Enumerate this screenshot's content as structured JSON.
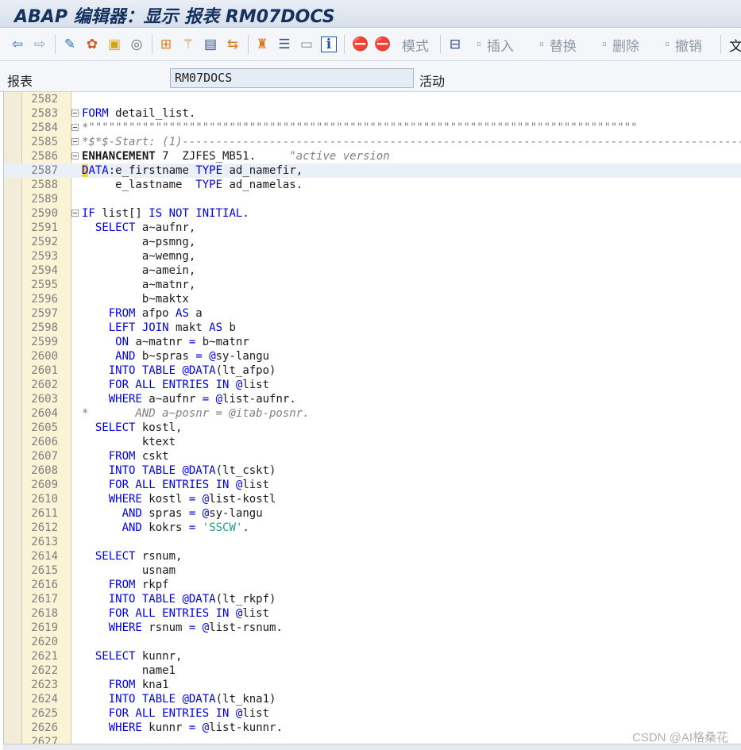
{
  "window": {
    "title": "ABAP 编辑器：显示 报表 RM07DOCS"
  },
  "toolbar": {
    "mode_label": "模式",
    "insert_label": "插入",
    "replace_label": "替换",
    "delete_label": "删除",
    "undo_label": "撤销",
    "doc_label": "文"
  },
  "report": {
    "label": "报表",
    "value": "RM07DOCS",
    "status": "活动"
  },
  "watermark": "CSDN @AI格桑花",
  "code": {
    "current_line": "2587",
    "lines": [
      {
        "n": "2582",
        "fold": false,
        "parts": []
      },
      {
        "n": "2583",
        "fold": true,
        "parts": [
          {
            "t": "FORM",
            "k": "k"
          },
          {
            "t": " detail_list.",
            "k": ""
          }
        ]
      },
      {
        "n": "2584",
        "fold": true,
        "parts": [
          {
            "t": "*\"\"\"\"\"\"\"\"\"\"\"\"\"\"\"\"\"\"\"\"\"\"\"\"\"\"\"\"\"\"\"\"\"\"\"\"\"\"\"\"\"\"\"\"\"\"\"\"\"\"\"\"\"\"\"\"\"\"\"\"\"\"\"\"\"\"\"\"\"\"\"\"\"\"\"\"\"\"\"\"\"\"",
            "k": "c"
          }
        ]
      },
      {
        "n": "2585",
        "fold": true,
        "parts": [
          {
            "t": "*$*$-Start: (1)----------------------------------------------------------------------------------------",
            "k": "c"
          }
        ]
      },
      {
        "n": "2586",
        "fold": true,
        "parts": [
          {
            "t": "ENHANCEMENT",
            "k": "b"
          },
          {
            "t": " 7  ZJFES_MB51.     ",
            "k": ""
          },
          {
            "t": "\"active version",
            "k": "c"
          }
        ]
      },
      {
        "n": "2587",
        "fold": false,
        "parts": [
          {
            "t": "D",
            "k": "k cursor"
          },
          {
            "t": "ATA",
            "k": "k"
          },
          {
            "t": ":e_firstname ",
            "k": ""
          },
          {
            "t": "TYPE",
            "k": "k"
          },
          {
            "t": " ad_namefir,",
            "k": ""
          }
        ]
      },
      {
        "n": "2588",
        "fold": false,
        "parts": [
          {
            "t": "     e_lastname  ",
            "k": ""
          },
          {
            "t": "TYPE",
            "k": "k"
          },
          {
            "t": " ad_namelas.",
            "k": ""
          }
        ]
      },
      {
        "n": "2589",
        "fold": false,
        "parts": []
      },
      {
        "n": "2590",
        "fold": true,
        "parts": [
          {
            "t": "IF",
            "k": "k"
          },
          {
            "t": " list[] ",
            "k": ""
          },
          {
            "t": "IS NOT INITIAL",
            "k": "k"
          },
          {
            "t": ".",
            "k": ""
          }
        ]
      },
      {
        "n": "2591",
        "fold": false,
        "parts": [
          {
            "t": "  ",
            "k": ""
          },
          {
            "t": "SELECT",
            "k": "k"
          },
          {
            "t": " a~aufnr,",
            "k": ""
          }
        ]
      },
      {
        "n": "2592",
        "fold": false,
        "parts": [
          {
            "t": "         a~psmng,",
            "k": ""
          }
        ]
      },
      {
        "n": "2593",
        "fold": false,
        "parts": [
          {
            "t": "         a~wemng,",
            "k": ""
          }
        ]
      },
      {
        "n": "2594",
        "fold": false,
        "parts": [
          {
            "t": "         a~amein,",
            "k": ""
          }
        ]
      },
      {
        "n": "2595",
        "fold": false,
        "parts": [
          {
            "t": "         a~matnr,",
            "k": ""
          }
        ]
      },
      {
        "n": "2596",
        "fold": false,
        "parts": [
          {
            "t": "         b~maktx",
            "k": ""
          }
        ]
      },
      {
        "n": "2597",
        "fold": false,
        "parts": [
          {
            "t": "    ",
            "k": ""
          },
          {
            "t": "FROM",
            "k": "k"
          },
          {
            "t": " afpo ",
            "k": ""
          },
          {
            "t": "AS",
            "k": "k"
          },
          {
            "t": " a",
            "k": ""
          }
        ]
      },
      {
        "n": "2598",
        "fold": false,
        "parts": [
          {
            "t": "    ",
            "k": ""
          },
          {
            "t": "LEFT JOIN",
            "k": "k"
          },
          {
            "t": " makt ",
            "k": ""
          },
          {
            "t": "AS",
            "k": "k"
          },
          {
            "t": " b",
            "k": ""
          }
        ]
      },
      {
        "n": "2599",
        "fold": false,
        "parts": [
          {
            "t": "     ",
            "k": ""
          },
          {
            "t": "ON",
            "k": "k"
          },
          {
            "t": " a~matnr ",
            "k": ""
          },
          {
            "t": "=",
            "k": "k"
          },
          {
            "t": " b~matnr",
            "k": ""
          }
        ]
      },
      {
        "n": "2600",
        "fold": false,
        "parts": [
          {
            "t": "     ",
            "k": ""
          },
          {
            "t": "AND",
            "k": "k"
          },
          {
            "t": " b~spras ",
            "k": ""
          },
          {
            "t": "=",
            "k": "k"
          },
          {
            "t": " ",
            "k": ""
          },
          {
            "t": "@",
            "k": "k"
          },
          {
            "t": "sy-langu",
            "k": ""
          }
        ]
      },
      {
        "n": "2601",
        "fold": false,
        "parts": [
          {
            "t": "    ",
            "k": ""
          },
          {
            "t": "INTO TABLE",
            "k": "k"
          },
          {
            "t": " ",
            "k": ""
          },
          {
            "t": "@DATA",
            "k": "k"
          },
          {
            "t": "(lt_afpo)",
            "k": ""
          }
        ]
      },
      {
        "n": "2602",
        "fold": false,
        "parts": [
          {
            "t": "    ",
            "k": ""
          },
          {
            "t": "FOR ALL ENTRIES IN",
            "k": "k"
          },
          {
            "t": " ",
            "k": ""
          },
          {
            "t": "@",
            "k": "k"
          },
          {
            "t": "list",
            "k": ""
          }
        ]
      },
      {
        "n": "2603",
        "fold": false,
        "parts": [
          {
            "t": "    ",
            "k": ""
          },
          {
            "t": "WHERE",
            "k": "k"
          },
          {
            "t": " a~aufnr ",
            "k": ""
          },
          {
            "t": "=",
            "k": "k"
          },
          {
            "t": " ",
            "k": ""
          },
          {
            "t": "@",
            "k": "k"
          },
          {
            "t": "list-aufnr.",
            "k": ""
          }
        ]
      },
      {
        "n": "2604",
        "fold": false,
        "parts": [
          {
            "t": "*       AND a~posnr = @itab-posnr.",
            "k": "c"
          }
        ]
      },
      {
        "n": "2605",
        "fold": false,
        "parts": [
          {
            "t": "  ",
            "k": ""
          },
          {
            "t": "SELECT",
            "k": "k"
          },
          {
            "t": " kostl,",
            "k": ""
          }
        ]
      },
      {
        "n": "2606",
        "fold": false,
        "parts": [
          {
            "t": "         ktext",
            "k": ""
          }
        ]
      },
      {
        "n": "2607",
        "fold": false,
        "parts": [
          {
            "t": "    ",
            "k": ""
          },
          {
            "t": "FROM",
            "k": "k"
          },
          {
            "t": " cskt",
            "k": ""
          }
        ]
      },
      {
        "n": "2608",
        "fold": false,
        "parts": [
          {
            "t": "    ",
            "k": ""
          },
          {
            "t": "INTO TABLE",
            "k": "k"
          },
          {
            "t": " ",
            "k": ""
          },
          {
            "t": "@DATA",
            "k": "k"
          },
          {
            "t": "(lt_cskt)",
            "k": ""
          }
        ]
      },
      {
        "n": "2609",
        "fold": false,
        "parts": [
          {
            "t": "    ",
            "k": ""
          },
          {
            "t": "FOR ALL ENTRIES IN",
            "k": "k"
          },
          {
            "t": " ",
            "k": ""
          },
          {
            "t": "@",
            "k": "k"
          },
          {
            "t": "list",
            "k": ""
          }
        ]
      },
      {
        "n": "2610",
        "fold": false,
        "parts": [
          {
            "t": "    ",
            "k": ""
          },
          {
            "t": "WHERE",
            "k": "k"
          },
          {
            "t": " kostl ",
            "k": ""
          },
          {
            "t": "=",
            "k": "k"
          },
          {
            "t": " ",
            "k": ""
          },
          {
            "t": "@",
            "k": "k"
          },
          {
            "t": "list-kostl",
            "k": ""
          }
        ]
      },
      {
        "n": "2611",
        "fold": false,
        "parts": [
          {
            "t": "      ",
            "k": ""
          },
          {
            "t": "AND",
            "k": "k"
          },
          {
            "t": " spras ",
            "k": ""
          },
          {
            "t": "=",
            "k": "k"
          },
          {
            "t": " ",
            "k": ""
          },
          {
            "t": "@",
            "k": "k"
          },
          {
            "t": "sy-langu",
            "k": ""
          }
        ]
      },
      {
        "n": "2612",
        "fold": false,
        "parts": [
          {
            "t": "      ",
            "k": ""
          },
          {
            "t": "AND",
            "k": "k"
          },
          {
            "t": " kokrs ",
            "k": ""
          },
          {
            "t": "=",
            "k": "k"
          },
          {
            "t": " ",
            "k": ""
          },
          {
            "t": "'SSCW'",
            "k": "s"
          },
          {
            "t": ".",
            "k": ""
          }
        ]
      },
      {
        "n": "2613",
        "fold": false,
        "parts": []
      },
      {
        "n": "2614",
        "fold": false,
        "parts": [
          {
            "t": "  ",
            "k": ""
          },
          {
            "t": "SELECT",
            "k": "k"
          },
          {
            "t": " rsnum,",
            "k": ""
          }
        ]
      },
      {
        "n": "2615",
        "fold": false,
        "parts": [
          {
            "t": "         usnam",
            "k": ""
          }
        ]
      },
      {
        "n": "2616",
        "fold": false,
        "parts": [
          {
            "t": "    ",
            "k": ""
          },
          {
            "t": "FROM",
            "k": "k"
          },
          {
            "t": " rkpf",
            "k": ""
          }
        ]
      },
      {
        "n": "2617",
        "fold": false,
        "parts": [
          {
            "t": "    ",
            "k": ""
          },
          {
            "t": "INTO TABLE",
            "k": "k"
          },
          {
            "t": " ",
            "k": ""
          },
          {
            "t": "@DATA",
            "k": "k"
          },
          {
            "t": "(lt_rkpf)",
            "k": ""
          }
        ]
      },
      {
        "n": "2618",
        "fold": false,
        "parts": [
          {
            "t": "    ",
            "k": ""
          },
          {
            "t": "FOR ALL ENTRIES IN",
            "k": "k"
          },
          {
            "t": " ",
            "k": ""
          },
          {
            "t": "@",
            "k": "k"
          },
          {
            "t": "list",
            "k": ""
          }
        ]
      },
      {
        "n": "2619",
        "fold": false,
        "parts": [
          {
            "t": "    ",
            "k": ""
          },
          {
            "t": "WHERE",
            "k": "k"
          },
          {
            "t": " rsnum ",
            "k": ""
          },
          {
            "t": "=",
            "k": "k"
          },
          {
            "t": " ",
            "k": ""
          },
          {
            "t": "@",
            "k": "k"
          },
          {
            "t": "list-rsnum.",
            "k": ""
          }
        ]
      },
      {
        "n": "2620",
        "fold": false,
        "parts": []
      },
      {
        "n": "2621",
        "fold": false,
        "parts": [
          {
            "t": "  ",
            "k": ""
          },
          {
            "t": "SELECT",
            "k": "k"
          },
          {
            "t": " kunnr,",
            "k": ""
          }
        ]
      },
      {
        "n": "2622",
        "fold": false,
        "parts": [
          {
            "t": "         name1",
            "k": ""
          }
        ]
      },
      {
        "n": "2623",
        "fold": false,
        "parts": [
          {
            "t": "    ",
            "k": ""
          },
          {
            "t": "FROM",
            "k": "k"
          },
          {
            "t": " kna1",
            "k": ""
          }
        ]
      },
      {
        "n": "2624",
        "fold": false,
        "parts": [
          {
            "t": "    ",
            "k": ""
          },
          {
            "t": "INTO TABLE",
            "k": "k"
          },
          {
            "t": " ",
            "k": ""
          },
          {
            "t": "@DATA",
            "k": "k"
          },
          {
            "t": "(lt_kna1)",
            "k": ""
          }
        ]
      },
      {
        "n": "2625",
        "fold": false,
        "parts": [
          {
            "t": "    ",
            "k": ""
          },
          {
            "t": "FOR ALL ENTRIES IN",
            "k": "k"
          },
          {
            "t": " ",
            "k": ""
          },
          {
            "t": "@",
            "k": "k"
          },
          {
            "t": "list",
            "k": ""
          }
        ]
      },
      {
        "n": "2626",
        "fold": false,
        "parts": [
          {
            "t": "    ",
            "k": ""
          },
          {
            "t": "WHERE",
            "k": "k"
          },
          {
            "t": " kunnr ",
            "k": ""
          },
          {
            "t": "=",
            "k": "k"
          },
          {
            "t": " ",
            "k": ""
          },
          {
            "t": "@",
            "k": "k"
          },
          {
            "t": "list-kunnr.",
            "k": ""
          }
        ]
      },
      {
        "n": "2627",
        "fold": false,
        "parts": []
      }
    ]
  }
}
